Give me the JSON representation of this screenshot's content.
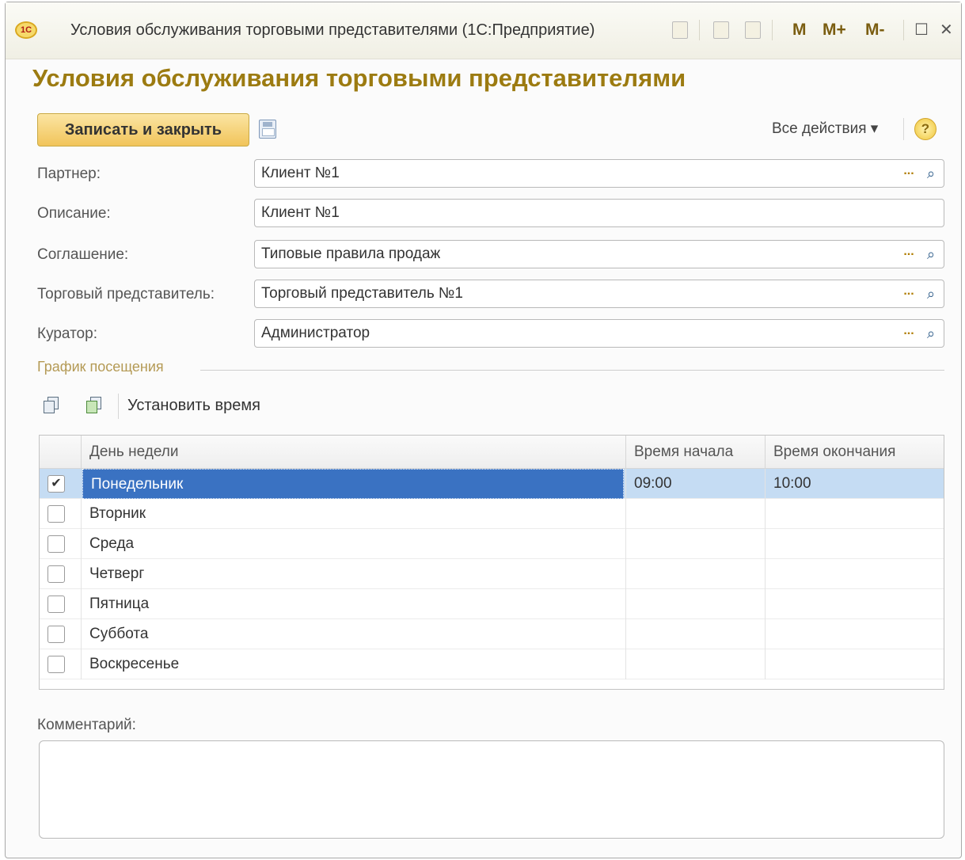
{
  "window": {
    "title": "Условия обслуживания торговыми представителями  (1С:Предприятие)",
    "logo_text": "1С",
    "m_label": "M",
    "mplus_label": "M+",
    "mminus_label": "M-",
    "maximize_glyph": "☐",
    "close_glyph": "✕"
  },
  "form": {
    "heading": "Условия обслуживания торговыми представителями",
    "save_close_label": "Записать и закрыть",
    "all_actions_label": "Все действия ▾",
    "help_glyph": "?"
  },
  "fields": {
    "partner": {
      "label": "Партнер:",
      "value": "Клиент №1"
    },
    "description": {
      "label": "Описание:",
      "value": "Клиент №1"
    },
    "agreement": {
      "label": "Соглашение:",
      "value": "Типовые правила продаж"
    },
    "sales_rep": {
      "label": "Торговый представитель:",
      "value": "Торговый представитель №1"
    },
    "curator": {
      "label": "Куратор:",
      "value": "Администратор"
    },
    "dots_glyph": "...",
    "lens_glyph": "🔍"
  },
  "schedule": {
    "group_title": "График посещения",
    "set_time_label": "Установить время",
    "columns": {
      "day": "День недели",
      "start": "Время начала",
      "end": "Время окончания"
    },
    "rows": [
      {
        "checked": "✔",
        "day": "Понедельник",
        "start": "09:00",
        "end": "10:00"
      },
      {
        "checked": "",
        "day": "Вторник",
        "start": "",
        "end": ""
      },
      {
        "checked": "",
        "day": "Среда",
        "start": "",
        "end": ""
      },
      {
        "checked": "",
        "day": "Четверг",
        "start": "",
        "end": ""
      },
      {
        "checked": "",
        "day": "Пятница",
        "start": "",
        "end": ""
      },
      {
        "checked": "",
        "day": "Суббота",
        "start": "",
        "end": ""
      },
      {
        "checked": "",
        "day": "Воскресенье",
        "start": "",
        "end": ""
      }
    ]
  },
  "comment": {
    "label": "Комментарий:",
    "value": ""
  }
}
